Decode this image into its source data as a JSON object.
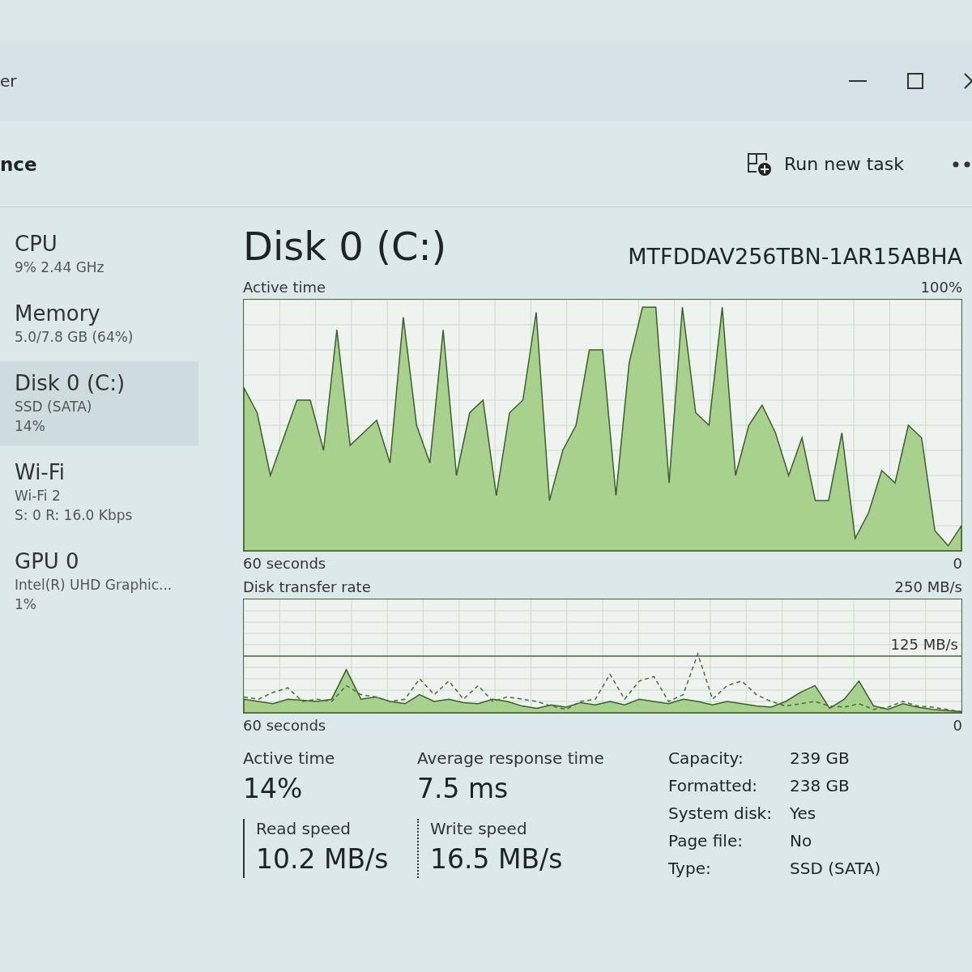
{
  "window": {
    "title": "er"
  },
  "header": {
    "title": "nce",
    "run_task": "Run new task"
  },
  "sidebar": {
    "items": [
      {
        "name": "CPU",
        "lines": [
          "9% 2.44 GHz"
        ],
        "selected": false
      },
      {
        "name": "Memory",
        "lines": [
          "5.0/7.8 GB (64%)"
        ],
        "selected": false
      },
      {
        "name": "Disk 0 (C:)",
        "lines": [
          "SSD (SATA)",
          "14%"
        ],
        "selected": true
      },
      {
        "name": "Wi-Fi",
        "lines": [
          "Wi-Fi 2",
          "S: 0 R: 16.0 Kbps"
        ],
        "selected": false
      },
      {
        "name": "GPU 0",
        "lines": [
          "Intel(R) UHD Graphic...",
          "1%"
        ],
        "selected": false
      }
    ]
  },
  "disk": {
    "title": "Disk 0 (C:)",
    "model": "MTFDDAV256TBN-1AR15ABHA",
    "active_chart": {
      "title": "Active time",
      "max_label": "100%",
      "time_label": "60 seconds",
      "min_label": "0"
    },
    "transfer_chart": {
      "title": "Disk transfer rate",
      "max_label": "250 MB/s",
      "mid_label": "125 MB/s",
      "time_label": "60 seconds",
      "min_label": "0"
    },
    "stats": [
      {
        "label": "Active time",
        "value": "14%"
      },
      {
        "label": "Average response time",
        "value": "7.5 ms"
      }
    ],
    "speeds": [
      {
        "kind": "read",
        "label": "Read speed",
        "value": "10.2 MB/s"
      },
      {
        "kind": "write",
        "label": "Write speed",
        "value": "16.5 MB/s"
      }
    ],
    "properties": [
      {
        "label": "Capacity:",
        "value": "239 GB"
      },
      {
        "label": "Formatted:",
        "value": "238 GB"
      },
      {
        "label": "System disk:",
        "value": "Yes"
      },
      {
        "label": "Page file:",
        "value": "No"
      },
      {
        "label": "Type:",
        "value": "SSD (SATA)"
      }
    ]
  }
}
